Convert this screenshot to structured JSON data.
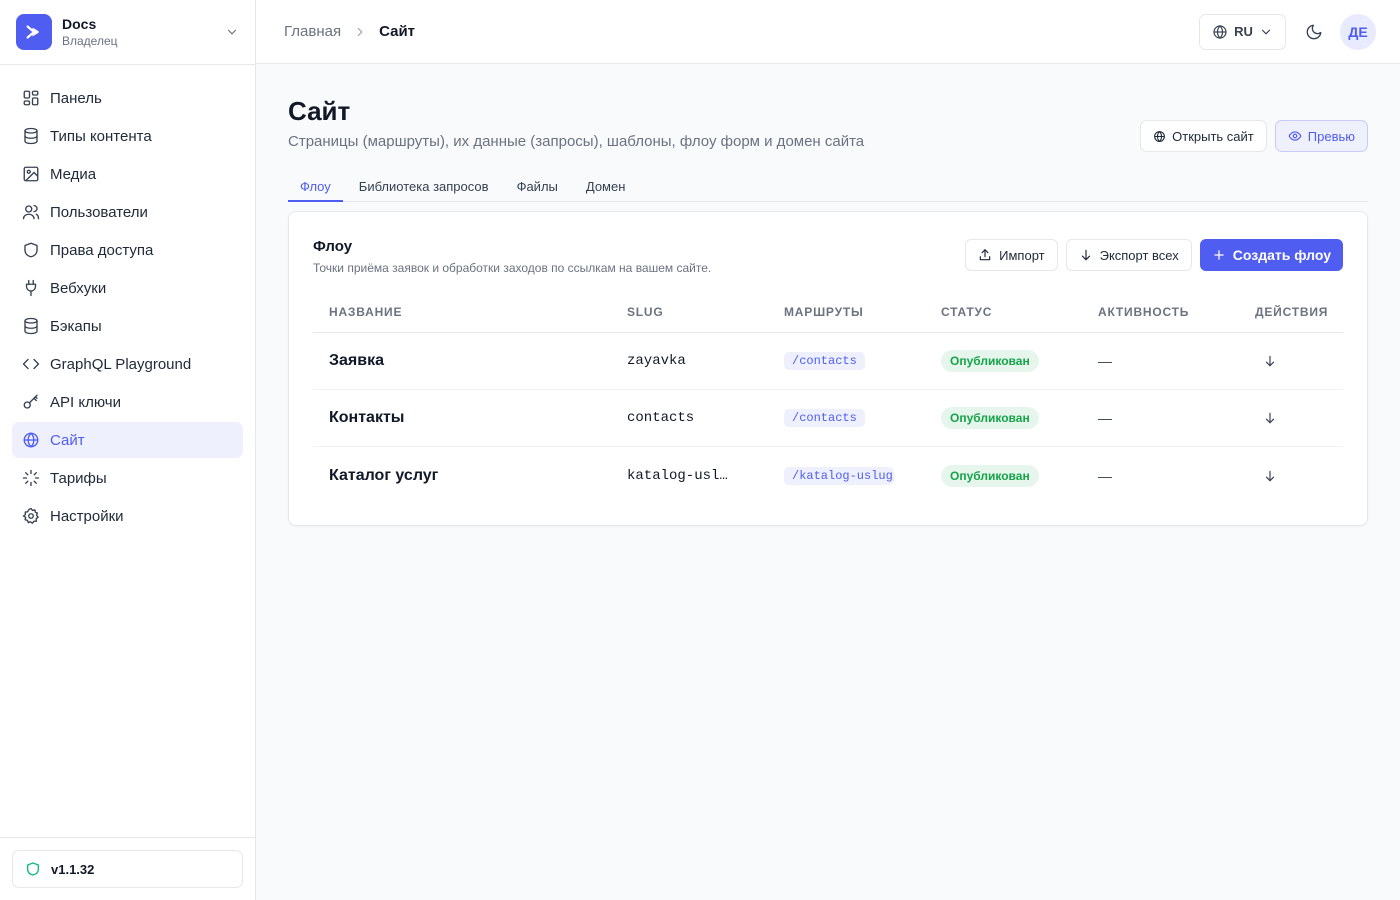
{
  "workspace": {
    "name": "Docs",
    "role": "Владелец"
  },
  "sidebar": {
    "items": [
      {
        "label": "Панель",
        "icon": "dashboard-icon"
      },
      {
        "label": "Типы контента",
        "icon": "database-icon"
      },
      {
        "label": "Медиа",
        "icon": "image-icon"
      },
      {
        "label": "Пользователи",
        "icon": "users-icon"
      },
      {
        "label": "Права доступа",
        "icon": "shield-icon"
      },
      {
        "label": "Вебхуки",
        "icon": "plug-icon"
      },
      {
        "label": "Бэкапы",
        "icon": "database-icon"
      },
      {
        "label": "GraphQL Playground",
        "icon": "code-icon"
      },
      {
        "label": "API ключи",
        "icon": "key-icon"
      },
      {
        "label": "Сайт",
        "icon": "globe-icon",
        "active": true
      },
      {
        "label": "Тарифы",
        "icon": "loader-icon"
      },
      {
        "label": "Настройки",
        "icon": "gear-icon"
      }
    ],
    "version": "v1.1.32"
  },
  "header": {
    "breadcrumb_home": "Главная",
    "breadcrumb_current": "Сайт",
    "language": "RU",
    "avatar_initials": "ДЕ"
  },
  "page": {
    "title": "Сайт",
    "subtitle": "Страницы (маршруты), их данные (запросы), шаблоны, флоу форм и домен сайта",
    "open_site_label": "Открыть сайт",
    "preview_label": "Превью",
    "tabs": [
      {
        "label": "Флоу",
        "active": true
      },
      {
        "label": "Библиотека запросов"
      },
      {
        "label": "Файлы"
      },
      {
        "label": "Домен"
      }
    ]
  },
  "flows": {
    "title": "Флоу",
    "subtitle": "Точки приёма заявок и обработки заходов по ссылкам на вашем сайте.",
    "import_label": "Импорт",
    "export_label": "Экспорт всех",
    "create_label": "Создать флоу",
    "columns": [
      "НАЗВАНИЕ",
      "SLUG",
      "МАРШРУТЫ",
      "СТАТУС",
      "АКТИВНОСТЬ",
      "ДЕЙСТВИЯ"
    ],
    "rows": [
      {
        "name": "Заявка",
        "slug": "zayavka",
        "route": "/contacts",
        "status": "Опубликован",
        "activity": "—"
      },
      {
        "name": "Контакты",
        "slug": "contacts",
        "route": "/contacts",
        "status": "Опубликован",
        "activity": "—"
      },
      {
        "name": "Каталог услуг",
        "slug": "katalog-usl…",
        "route": "/katalog-uslug",
        "status": "Опубликован",
        "activity": "—"
      }
    ]
  },
  "colors": {
    "accent": "#4f5df0",
    "success": "#16a34a",
    "border": "#e5e7eb"
  }
}
